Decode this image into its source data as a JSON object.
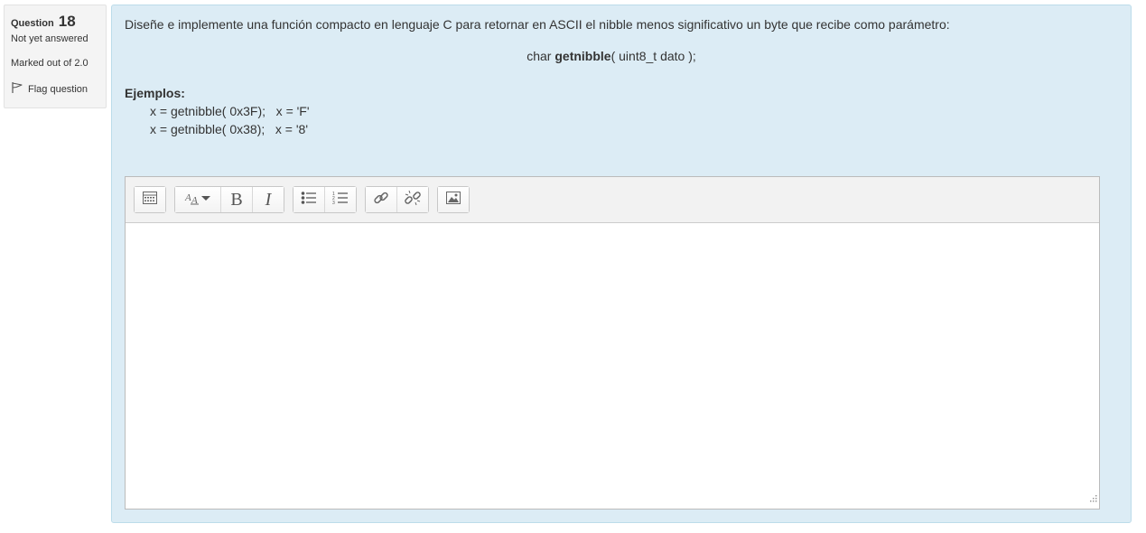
{
  "info": {
    "question_label": "Question",
    "question_number": "18",
    "state": "Not yet answered",
    "grade": "Marked out of 2.0",
    "flag_label": "Flag question"
  },
  "question": {
    "text": "Diseñe e implemente una función compacto en lenguaje C para retornar en ASCII el nibble menos significativo un byte que recibe como parámetro:",
    "signature_prefix": "char ",
    "signature_name": "getnibble",
    "signature_suffix": "( uint8_t dato );",
    "examples_title": "Ejemplos:",
    "examples": [
      "x = getnibble( 0x3F);   x = 'F'",
      "x = getnibble( 0x38);   x = '8'"
    ]
  },
  "editor": {
    "content": "",
    "toolbar_icons": [
      "toolbar-toggle-icon",
      "font-style-icon",
      "bold-icon",
      "italic-icon",
      "unordered-list-icon",
      "ordered-list-icon",
      "link-icon",
      "unlink-icon",
      "image-icon"
    ]
  },
  "colors": {
    "content_bg": "#dcecf5",
    "content_border": "#bcdcea",
    "info_bg": "#f4f4f4"
  }
}
